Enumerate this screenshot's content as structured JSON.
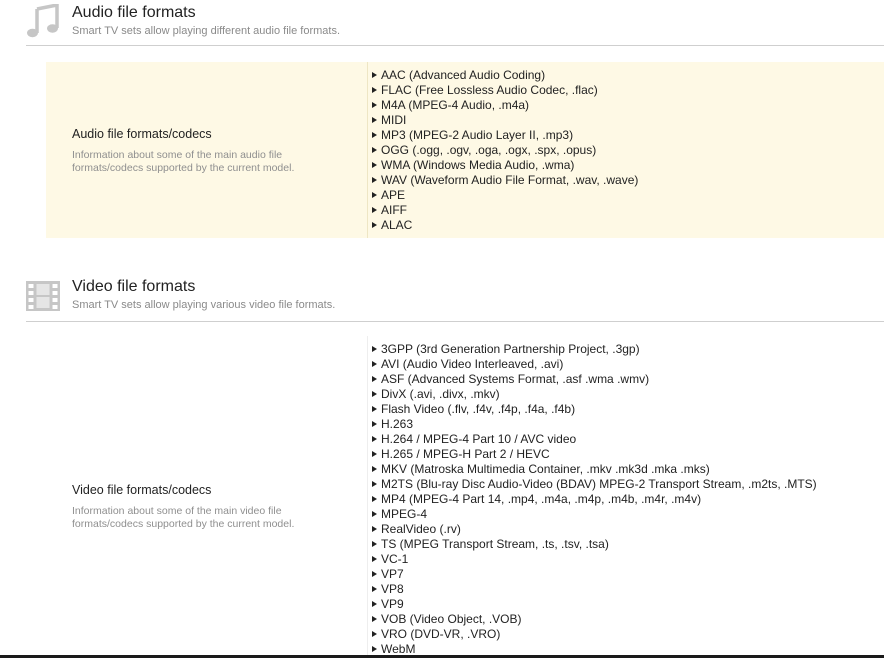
{
  "audio": {
    "icon": "music-note-icon",
    "title": "Audio file formats",
    "subtitle": "Smart TV sets allow playing different audio file formats.",
    "row": {
      "label": "Audio file formats/codecs",
      "description": "Information about some of the main audio file formats/codecs supported by the current model.",
      "items": [
        "AAC (Advanced Audio Coding)",
        "FLAC (Free Lossless Audio Codec, .flac)",
        "M4A (MPEG-4 Audio, .m4a)",
        "MIDI",
        "MP3 (MPEG-2 Audio Layer II, .mp3)",
        "OGG (.ogg, .ogv, .oga, .ogx, .spx, .opus)",
        "WMA (Windows Media Audio, .wma)",
        "WAV (Waveform Audio File Format, .wav, .wave)",
        "APE",
        "AIFF",
        "ALAC"
      ]
    }
  },
  "video": {
    "icon": "film-strip-icon",
    "title": "Video file formats",
    "subtitle": "Smart TV sets allow playing various video file formats.",
    "row": {
      "label": "Video file formats/codecs",
      "description": "Information about some of the main video file formats/codecs supported by the current model.",
      "items": [
        "3GPP (3rd Generation Partnership Project, .3gp)",
        "AVI (Audio Video Interleaved, .avi)",
        "ASF (Advanced Systems Format, .asf .wma .wmv)",
        "DivX (.avi, .divx, .mkv)",
        "Flash Video (.flv, .f4v, .f4p, .f4a, .f4b)",
        "H.263",
        "H.264 / MPEG-4 Part 10 / AVC video",
        "H.265 / MPEG-H Part 2 / HEVC",
        "MKV (Matroska Multimedia Container, .mkv .mk3d .mka .mks)",
        "M2TS (Blu-ray Disc Audio-Video (BDAV) MPEG-2 Transport Stream, .m2ts, .MTS)",
        "MP4 (MPEG-4 Part 14, .mp4, .m4a, .m4p, .m4b, .m4r, .m4v)",
        "MPEG-4",
        "RealVideo (.rv)",
        "TS (MPEG Transport Stream, .ts, .tsv, .tsa)",
        "VC-1",
        "VP7",
        "VP8",
        "VP9",
        "VOB (Video Object, .VOB)",
        "VRO (DVD-VR, .VRO)",
        "WebM"
      ]
    }
  },
  "colors": {
    "highlight_row": "#fef9e5",
    "icon_gray": "#c6c6c6",
    "muted_text": "#8f8f8f"
  }
}
